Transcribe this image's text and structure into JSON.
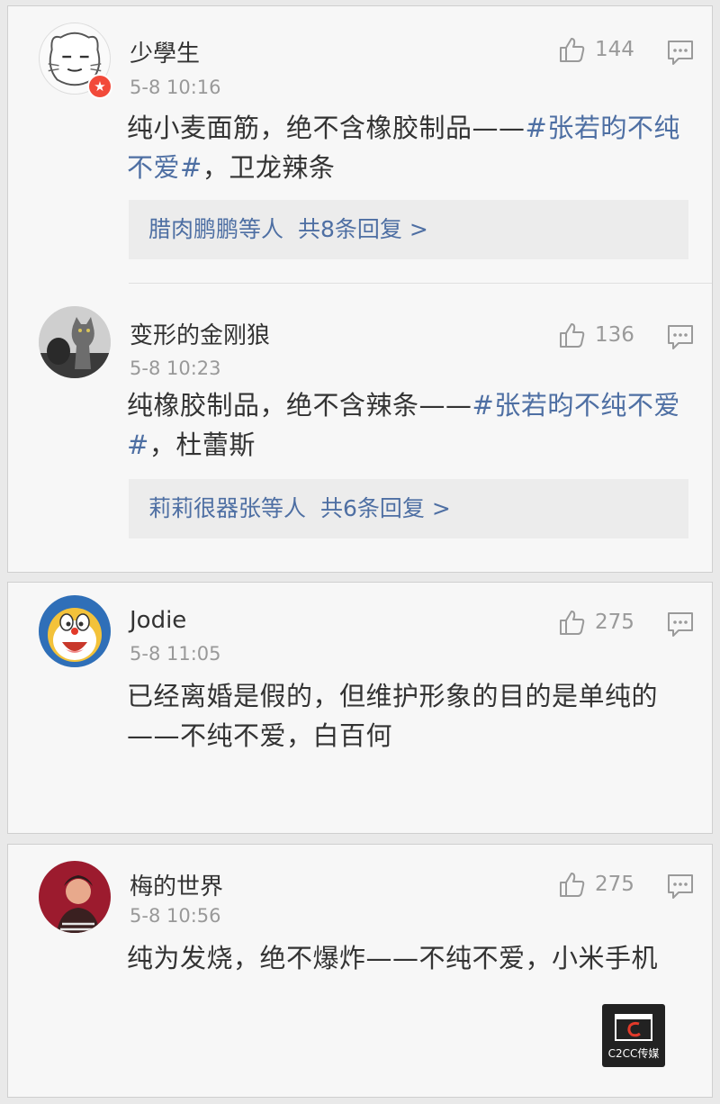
{
  "comments": [
    {
      "username": "少學生",
      "time": "5-8 10:16",
      "likes": "144",
      "text_prefix": "纯小麦面筋，绝不含橡胶制品——",
      "tag": "#张若昀不纯不爱#",
      "text_suffix": "，卫龙辣条",
      "replies": {
        "names": "腊肉鹏鹏等人",
        "count": "共8条回复 >"
      },
      "avatar_icon": "cat-sketch-avatar",
      "badge_icon": "vip-star-badge"
    },
    {
      "username": "变形的金刚狼",
      "time": "5-8 10:23",
      "likes": "136",
      "text_prefix": "纯橡胶制品，绝不含辣条——",
      "tag": "#张若昀不纯不爱#",
      "text_suffix": "，杜蕾斯",
      "replies": {
        "names": "莉莉很器张等人",
        "count": "共6条回复 >"
      },
      "avatar_icon": "cat-photo-avatar"
    },
    {
      "username": "Jodie",
      "time": "5-8 11:05",
      "likes": "275",
      "text": "已经离婚是假的，但维护形象的目的是单纯的——不纯不爱，白百何",
      "avatar_icon": "doraemon-avatar"
    },
    {
      "username": "梅的世界",
      "time": "5-8 10:56",
      "likes": "275",
      "text": "纯为发烧，绝不爆炸——不纯不爱，小米手机",
      "avatar_icon": "person-photo-avatar"
    }
  ],
  "watermark": {
    "label": "C2CC传媒"
  },
  "colors": {
    "link": "#4e6fa3",
    "badge": "#f24a3a",
    "meta": "#999999"
  }
}
